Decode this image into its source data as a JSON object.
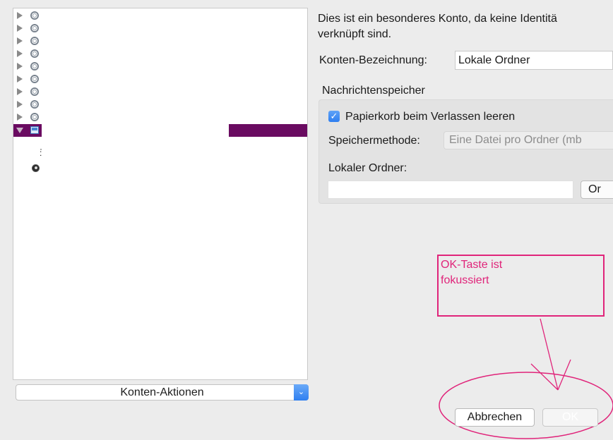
{
  "tree": {
    "collapsed_rows": 9,
    "selected_row_icon": "local-folders-icon",
    "account_icon": "account-target-icon",
    "sub_icon": "smart-folder-icon"
  },
  "account_actions": {
    "label": "Konten-Aktionen",
    "chevron": "⌄"
  },
  "description": {
    "line1": "Dies ist ein besonderes Konto, da keine Identitä",
    "line2": "verknüpft sind."
  },
  "account_name": {
    "label": "Konten-Bezeichnung:",
    "value": "Lokale Ordner"
  },
  "storage": {
    "title": "Nachrichtenspeicher",
    "empty_trash": {
      "label": "Papierkorb beim Verlassen leeren",
      "checked": true
    },
    "method": {
      "label": "Speichermethode:",
      "value": "Eine Datei pro Ordner (mb"
    },
    "local_dir": {
      "label": "Lokaler Ordner:",
      "value": "",
      "browse_label": "Or"
    }
  },
  "annotation": {
    "line1": "OK-Taste ist",
    "line2": "fokussiert",
    "color": "#e0247a"
  },
  "buttons": {
    "cancel": "Abbrechen",
    "ok": "OK"
  },
  "colors": {
    "selection": "#6a0b61",
    "accent": "#2f7ff0"
  }
}
